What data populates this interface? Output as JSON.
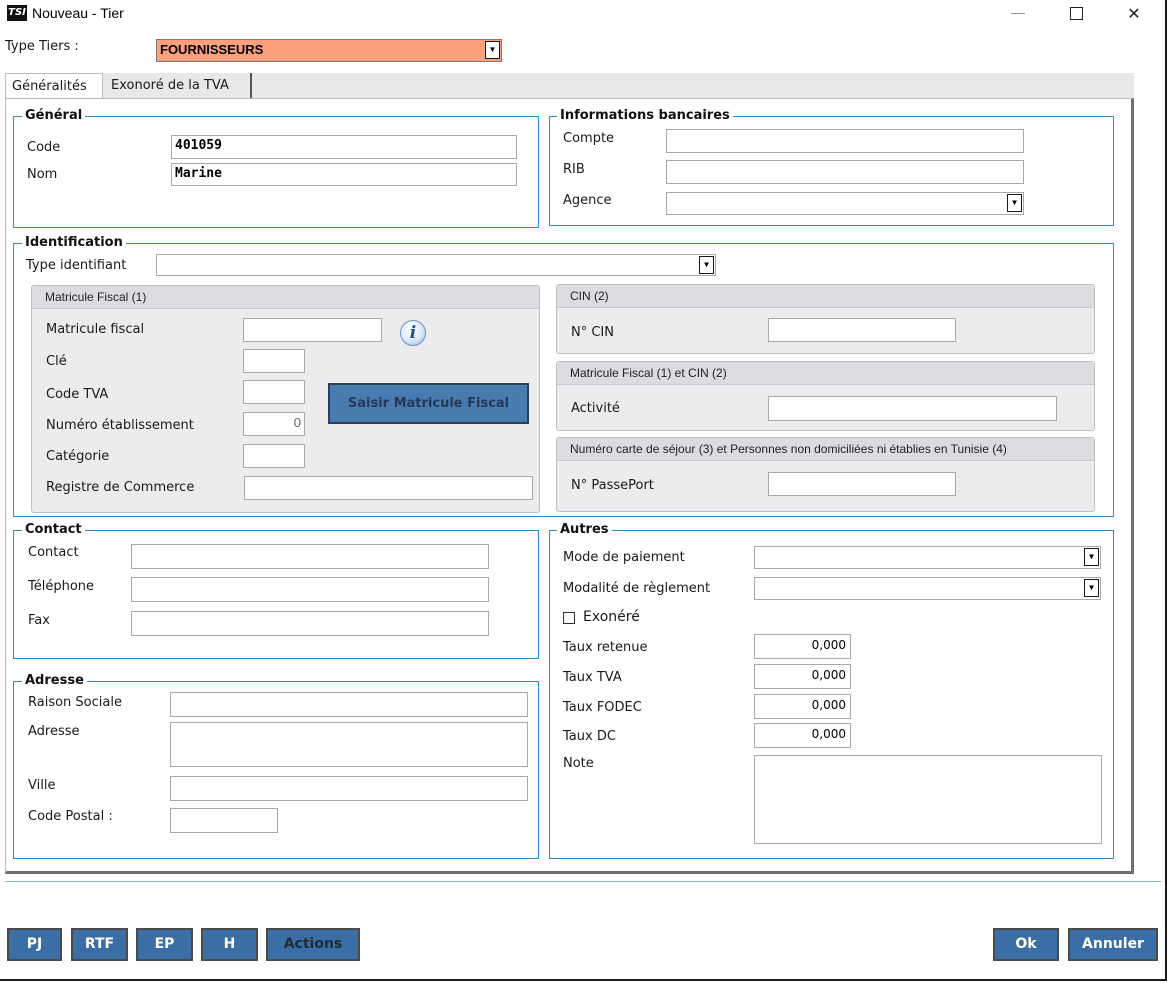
{
  "window": {
    "app_icon": "TSI",
    "title": "Nouveau - Tier",
    "minimize": "—",
    "close": "✕"
  },
  "type_tiers": {
    "label": "Type Tiers :",
    "value": "FOURNISSEURS",
    "color": "#fba07a"
  },
  "tabs": [
    {
      "label": "Généralités",
      "active": true
    },
    {
      "label": "Exonoré de la TVA",
      "active": false
    }
  ],
  "general": {
    "title": "Général",
    "code_label": "Code",
    "code_value": "401059",
    "nom_label": "Nom",
    "nom_value": "Marine"
  },
  "banque": {
    "title": "Informations bancaires",
    "compte_label": "Compte",
    "compte_value": "",
    "rib_label": "RIB",
    "rib_value": "",
    "agence_label": "Agence",
    "agence_value": ""
  },
  "identification": {
    "title": "Identification",
    "type_label": "Type identifiant",
    "type_value": "",
    "mf_panel": {
      "title": "Matricule Fiscal (1)",
      "matricule_label": "Matricule fiscal",
      "cle_label": "Clé",
      "code_tva_label": "Code TVA",
      "numero_label": "Numéro établissement",
      "numero_value": "0",
      "categorie_label": "Catégorie",
      "registre_label": "Registre de Commerce",
      "saisir_button": "Saisir Matricule Fiscal",
      "info_icon": "i"
    },
    "cin_panel": {
      "title": "CIN (2)",
      "cin_label": "N° CIN"
    },
    "mf_cin_panel": {
      "title": "Matricule Fiscal (1) et CIN (2)",
      "activite_label": "Activité"
    },
    "sejour_panel": {
      "title": "Numéro carte de séjour (3) et Personnes non domiciliées ni établies en Tunisie (4)",
      "passeport_label": "N° PassePort"
    }
  },
  "contact": {
    "title": "Contact",
    "contact_label": "Contact",
    "telephone_label": "Téléphone",
    "fax_label": "Fax"
  },
  "adresse": {
    "title": "Adresse",
    "raison_label": "Raison Sociale",
    "adresse_label": "Adresse",
    "ville_label": "Ville",
    "cp_label": "Code Postal :"
  },
  "autres": {
    "title": "Autres",
    "mode_label": "Mode de paiement",
    "modalite_label": "Modalité de règlement",
    "exonere_label": "Exonéré",
    "exonere_checked": false,
    "taux_retenue_label": "Taux retenue",
    "taux_retenue_value": "0,000",
    "taux_tva_label": "Taux TVA",
    "taux_tva_value": "0,000",
    "taux_fodec_label": "Taux FODEC",
    "taux_fodec_value": "0,000",
    "taux_dc_label": "Taux DC",
    "taux_dc_value": "0,000",
    "note_label": "Note"
  },
  "footer": {
    "pj": "PJ",
    "rtf": "RTF",
    "ep": "EP",
    "h": "H",
    "actions": "Actions",
    "ok": "Ok",
    "annuler": "Annuler"
  },
  "colors": {
    "accent": "#2a8fcf",
    "button": "#3a6ea5",
    "panel_bg": "#ececef"
  }
}
